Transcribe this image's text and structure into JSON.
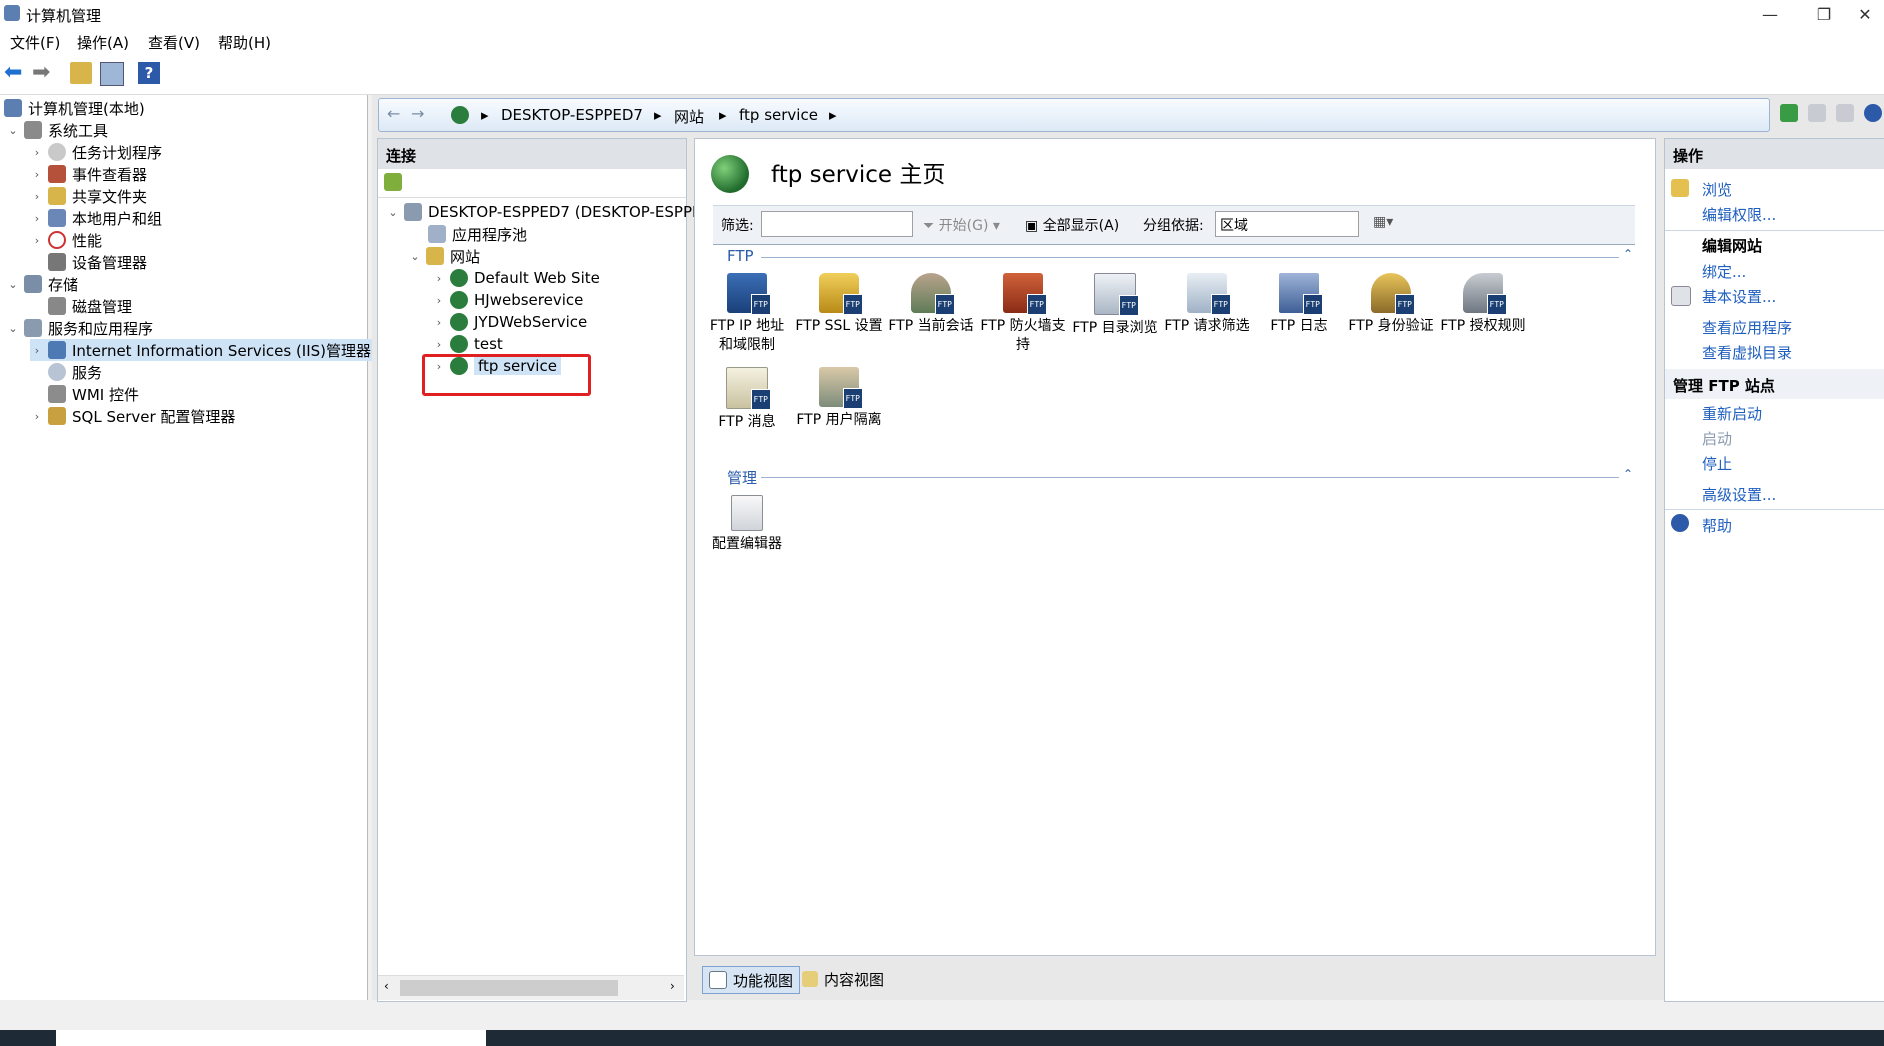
{
  "window": {
    "title": "计算机管理"
  },
  "menu": [
    "文件(F)",
    "操作(A)",
    "查看(V)",
    "帮助(H)"
  ],
  "tree": {
    "root": "计算机管理(本地)",
    "system_tools": "系统工具",
    "task_scheduler": "任务计划程序",
    "event_viewer": "事件查看器",
    "shared_folders": "共享文件夹",
    "local_users": "本地用户和组",
    "performance": "性能",
    "device_manager": "设备管理器",
    "storage": "存储",
    "disk_management": "磁盘管理",
    "services_apps": "服务和应用程序",
    "iis_manager": "Internet Information Services (IIS)管理器",
    "services": "服务",
    "wmi": "WMI 控件",
    "sql": "SQL Server 配置管理器"
  },
  "breadcrumb": [
    "DESKTOP-ESPPED7",
    "网站",
    "ftp service"
  ],
  "connections": {
    "title": "连接",
    "server": "DESKTOP-ESPPED7 (DESKTOP-ESPPE",
    "app_pools": "应用程序池",
    "sites": "网站",
    "site_list": [
      "Default Web Site",
      "HJwebserevice",
      "JYDWebService",
      "test",
      "ftp service"
    ]
  },
  "main": {
    "title": "ftp service 主页",
    "filter_label": "筛选:",
    "filter_value": "",
    "go_label": "开始(G)",
    "show_all_label": "全部显示(A)",
    "group_label": "分组依据:",
    "group_value": "区域",
    "group_ftp": "FTP",
    "group_manage": "管理",
    "ftp_features": [
      [
        "FTP IP 地址",
        "和域限制"
      ],
      [
        "FTP SSL 设置",
        ""
      ],
      [
        "FTP 当前会话",
        ""
      ],
      [
        "FTP 防火墙支",
        "持"
      ],
      [
        "FTP 目录浏览",
        ""
      ],
      [
        "FTP 请求筛选",
        ""
      ],
      [
        "FTP 日志",
        ""
      ],
      [
        "FTP 身份验证",
        ""
      ],
      [
        "FTP 授权规则",
        ""
      ],
      [
        "FTP 消息",
        ""
      ],
      [
        "FTP 用户隔离",
        ""
      ]
    ],
    "ftp_tag": "FTP",
    "manage_features": [
      "配置编辑器"
    ]
  },
  "view_tabs": [
    "功能视图",
    "内容视图"
  ],
  "actions": {
    "title": "操作",
    "browse": "浏览",
    "edit_permissions": "编辑权限...",
    "edit_site": "编辑网站",
    "bindings": "绑定...",
    "basic_settings": "基本设置...",
    "view_apps": "查看应用程序",
    "view_vdirs": "查看虚拟目录",
    "manage_ftp": "管理 FTP 站点",
    "restart": "重新启动",
    "start": "启动",
    "stop": "停止",
    "advanced": "高级设置...",
    "help": "帮助"
  },
  "colors": {
    "accent": "#1f5fbf",
    "highlight_box": "#e02020"
  }
}
